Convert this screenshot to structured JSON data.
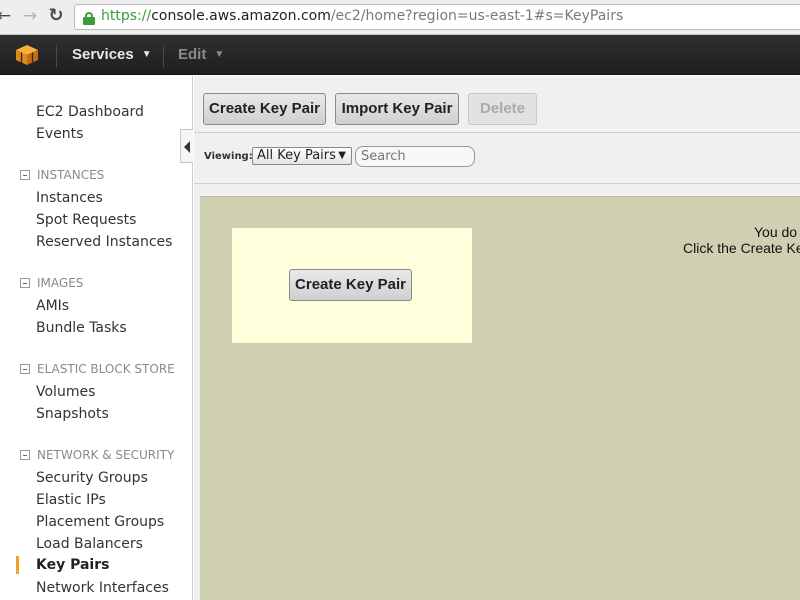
{
  "browser": {
    "url_scheme": "https://",
    "url_host": "console.aws.amazon.com",
    "url_path": "/ec2/home?region=us-east-1#s=KeyPairs",
    "back_icon": "arrow-left-icon",
    "forward_icon": "arrow-right-icon",
    "reload_icon": "reload-icon",
    "secure_color": "#3c9b3c"
  },
  "topnav": {
    "services_label": "Services",
    "edit_label": "Edit",
    "logo_color": "#f0a030"
  },
  "sidebar": {
    "dashboard": "EC2 Dashboard",
    "events": "Events",
    "instances_heading": "INSTANCES",
    "instances": "Instances",
    "spot_requests": "Spot Requests",
    "reserved_instances": "Reserved Instances",
    "images_heading": "IMAGES",
    "amis": "AMIs",
    "bundle_tasks": "Bundle Tasks",
    "ebs_heading": "ELASTIC BLOCK STORE",
    "volumes": "Volumes",
    "snapshots": "Snapshots",
    "network_heading": "NETWORK & SECURITY",
    "security_groups": "Security Groups",
    "elastic_ips": "Elastic IPs",
    "placement_groups": "Placement Groups",
    "load_balancers": "Load Balancers",
    "key_pairs": "Key Pairs",
    "network_interfaces": "Network Interfaces",
    "active_color": "#f0a030"
  },
  "toolbar": {
    "create_label": "Create Key Pair",
    "import_label": "Import Key Pair",
    "delete_label": "Delete"
  },
  "filter": {
    "viewing_label": "Viewing:",
    "selected_option": "All Key Pairs",
    "search_placeholder": "Search"
  },
  "empty_state": {
    "create_label": "Create Key Pair",
    "message_line1": "You do",
    "message_line2": "Click the Create Key",
    "panel_color": "#cfcfb1",
    "box_color": "#ffffdc"
  }
}
